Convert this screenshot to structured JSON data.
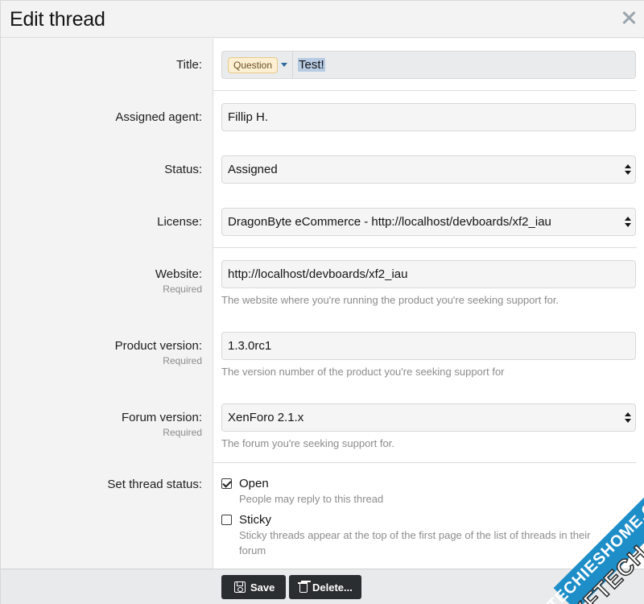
{
  "dialog": {
    "title": "Edit thread"
  },
  "fields": {
    "title": {
      "label": "Title:",
      "prefix": "Question",
      "value": "Test!"
    },
    "assigned_agent": {
      "label": "Assigned agent:",
      "value": "Fillip H."
    },
    "status": {
      "label": "Status:",
      "value": "Assigned"
    },
    "license": {
      "label": "License:",
      "value": "DragonByte eCommerce - http://localhost/devboards/xf2_iau"
    },
    "website": {
      "label": "Website:",
      "required": "Required",
      "value": "http://localhost/devboards/xf2_iau",
      "hint": "The website where you're running the product you're seeking support for."
    },
    "product_version": {
      "label": "Product version:",
      "required": "Required",
      "value": "1.3.0rc1",
      "hint": "The version number of the product you're seeking support for"
    },
    "forum_version": {
      "label": "Forum version:",
      "required": "Required",
      "value": "XenForo 2.1.x",
      "hint": "The forum you're seeking support for."
    },
    "thread_status": {
      "label": "Set thread status:",
      "options": [
        {
          "label": "Open",
          "hint": "People may reply to this thread",
          "checked": true
        },
        {
          "label": "Sticky",
          "hint": "Sticky threads appear at the top of the first page of the list of threads in their forum",
          "checked": false
        }
      ]
    }
  },
  "footer": {
    "save_label": "Save",
    "delete_label": "Delete..."
  },
  "watermark": {
    "line1": "TECHIESHOME.COM",
    "line2": "XFTECH"
  },
  "colors": {
    "prefix_bg": "#fcefd2",
    "prefix_border": "#e8c98a",
    "button_bg": "#2b2e30",
    "selection": "#b7cbe3",
    "watermark_band": "#1e8ec9"
  }
}
